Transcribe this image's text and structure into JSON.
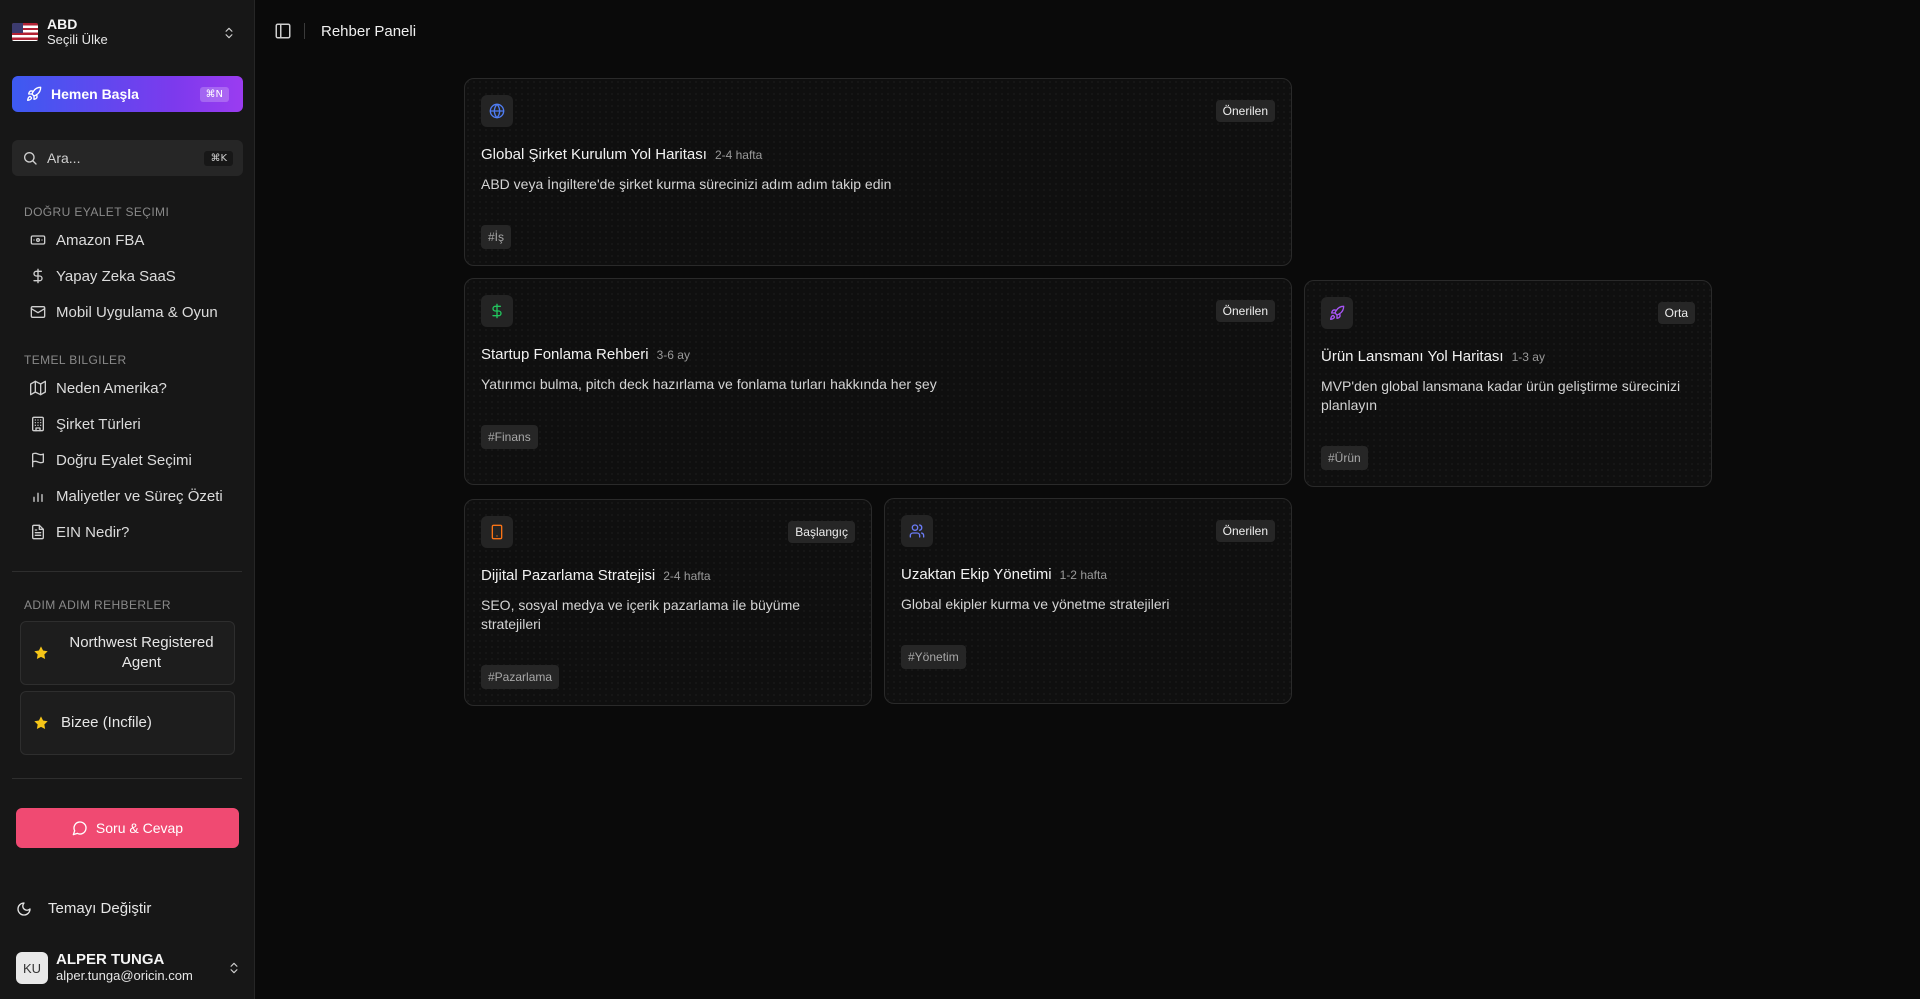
{
  "country": {
    "name": "ABD",
    "subtitle": "Seçili Ülke"
  },
  "start_button": {
    "label": "Hemen Başla",
    "shortcut": "⌘N"
  },
  "search": {
    "placeholder": "Ara...",
    "shortcut": "⌘K"
  },
  "sections": {
    "state": {
      "label": "DOĞRU EYALET SEÇIMI",
      "items": [
        {
          "label": "Amazon FBA",
          "icon": "banknote-icon"
        },
        {
          "label": "Yapay Zeka SaaS",
          "icon": "dollar-icon"
        },
        {
          "label": "Mobil Uygulama & Oyun",
          "icon": "mail-icon"
        }
      ]
    },
    "basics": {
      "label": "TEMEL BILGILER",
      "items": [
        {
          "label": "Neden Amerika?",
          "icon": "map-icon"
        },
        {
          "label": "Şirket Türleri",
          "icon": "building-icon"
        },
        {
          "label": "Doğru Eyalet Seçimi",
          "icon": "flag-icon"
        },
        {
          "label": "Maliyetler ve Süreç Özeti",
          "icon": "bar-chart-icon"
        },
        {
          "label": "EIN Nedir?",
          "icon": "document-icon"
        }
      ]
    },
    "guides": {
      "label": "ADIM ADIM REHBERLER",
      "items": [
        {
          "label": "Northwest Registered Agent",
          "icon": "star-icon"
        },
        {
          "label": "Bizee (Incfile)",
          "icon": "star-icon"
        }
      ]
    }
  },
  "qa_button": {
    "label": "Soru & Cevap"
  },
  "theme_toggle": {
    "label": "Temayı Değiştir"
  },
  "user": {
    "initials": "KU",
    "name": "ALPER TUNGA",
    "email": "alper.tunga@oricin.com"
  },
  "header": {
    "title": "Rehber Paneli"
  },
  "cards": [
    {
      "title": "Global Şirket Kurulum Yol Haritası",
      "duration": "2-4 hafta",
      "description": "ABD veya İngiltere'de şirket kurma sürecinizi adım adım takip edin",
      "badge": "Önerilen",
      "tag": "#İş",
      "icon": "globe-icon",
      "icon_color": "#4f7df3"
    },
    {
      "title": "Startup Fonlama Rehberi",
      "duration": "3-6 ay",
      "description": "Yatırımcı bulma, pitch deck hazırlama ve fonlama turları hakkında her şey",
      "badge": "Önerilen",
      "tag": "#Finans",
      "icon": "dollar-icon",
      "icon_color": "#22c55e"
    },
    {
      "title": "Ürün Lansmanı Yol Haritası",
      "duration": "1-3 ay",
      "description": "MVP'den global lansmana kadar ürün geliştirme sürecinizi planlayın",
      "badge": "Orta",
      "tag": "#Ürün",
      "icon": "rocket-icon",
      "icon_color": "#a855f7"
    },
    {
      "title": "Dijital Pazarlama Stratejisi",
      "duration": "2-4 hafta",
      "description": "SEO, sosyal medya ve içerik pazarlama ile büyüme stratejileri",
      "badge": "Başlangıç",
      "tag": "#Pazarlama",
      "icon": "smartphone-icon",
      "icon_color": "#f97316"
    },
    {
      "title": "Uzaktan Ekip Yönetimi",
      "duration": "1-2 hafta",
      "description": "Global ekipler kurma ve yönetme stratejileri",
      "badge": "Önerilen",
      "tag": "#Yönetim",
      "icon": "users-icon",
      "icon_color": "#6b7cf7"
    }
  ],
  "colors": {
    "accent_gradient_start": "#3d5af1",
    "accent_gradient_end": "#9b3cf0",
    "qa_button": "#f04a72",
    "background": "#0a0a0a",
    "sidebar": "#171717",
    "star": "#f5c518"
  }
}
